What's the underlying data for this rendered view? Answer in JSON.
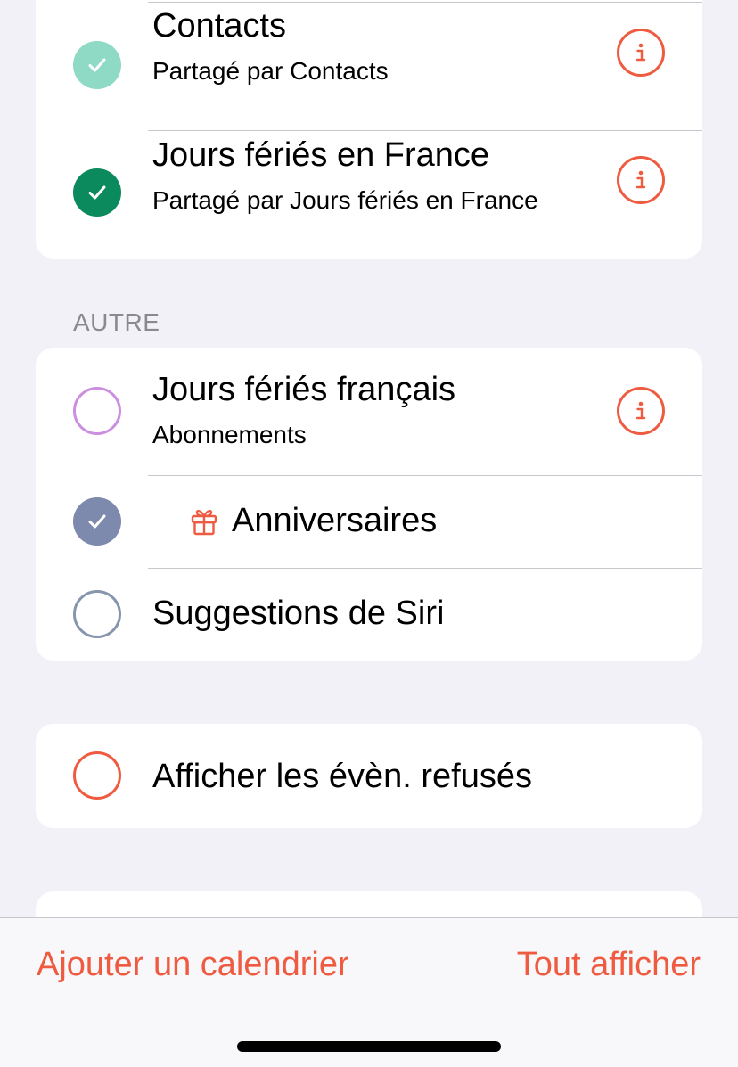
{
  "sections": {
    "shared_items": [
      {
        "title": "Contacts",
        "subtitle": "Partagé par Contacts",
        "checked": true,
        "color": "#8fdac4"
      },
      {
        "title": "Jours fériés en France",
        "subtitle": "Partagé par Jours fériés en France",
        "checked": true,
        "color": "#0b8a5e"
      }
    ],
    "other": {
      "header": "AUTRE",
      "items": [
        {
          "title": "Jours fériés français",
          "subtitle": "Abonnements",
          "checked": false,
          "color": "#cc8ee0"
        },
        {
          "title": "Anniversaires",
          "checked": true,
          "color": "#7d8aad",
          "icon": "gift-icon"
        },
        {
          "title": "Suggestions de Siri",
          "checked": false,
          "color": "#8596ad"
        }
      ]
    },
    "declined": {
      "title": "Afficher les évèn. refusés",
      "checked": false,
      "color": "#ef5b41"
    }
  },
  "toolbar": {
    "add_calendar": "Ajouter un calendrier",
    "show_all": "Tout afficher"
  },
  "colors": {
    "accent": "#ef5b41",
    "background": "#f2f1f7"
  }
}
